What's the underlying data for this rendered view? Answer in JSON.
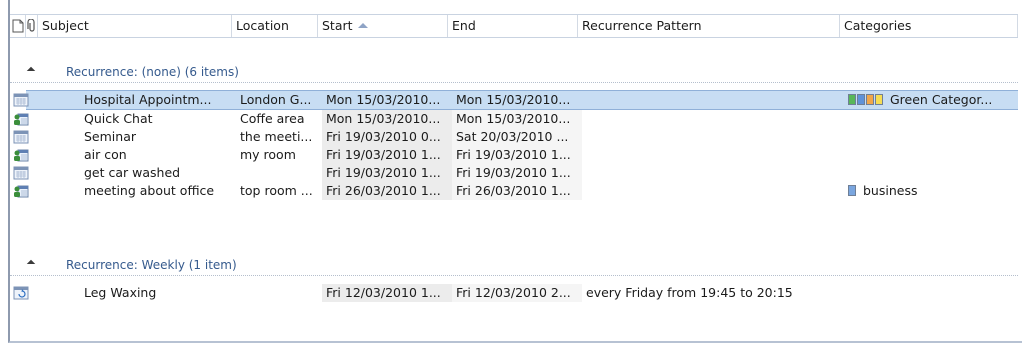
{
  "header": {
    "columns": [
      "Subject",
      "Location",
      "Start",
      "End",
      "Recurrence Pattern",
      "Categories"
    ]
  },
  "groups": [
    {
      "label": "Recurrence: (none) (6 items)",
      "rows": [
        {
          "icon": "appointment-icon",
          "subject": "Hospital Appointm...",
          "location": "London G...",
          "start": "Mon 15/03/2010...",
          "end": "Mon 15/03/2010...",
          "pattern": "",
          "categories": "Green Categor...",
          "swatches": [
            "#58b758",
            "#5f92d8",
            "#f0a64a",
            "#f5dd54"
          ],
          "selected": true
        },
        {
          "icon": "meeting-icon",
          "subject": "Quick Chat",
          "location": "Coffe area",
          "start": "Mon 15/03/2010...",
          "end": "Mon 15/03/2010...",
          "pattern": "",
          "categories": "",
          "swatches": []
        },
        {
          "icon": "appointment-icon",
          "subject": "Seminar",
          "location": "the meeti...",
          "start": "Fri 19/03/2010 0...",
          "end": "Sat 20/03/2010 ...",
          "pattern": "",
          "categories": "",
          "swatches": []
        },
        {
          "icon": "meeting-icon",
          "subject": "air con",
          "location": "my room",
          "start": "Fri 19/03/2010 1...",
          "end": "Fri 19/03/2010 1...",
          "pattern": "",
          "categories": "",
          "swatches": []
        },
        {
          "icon": "appointment-icon",
          "subject": "get car washed",
          "location": "",
          "start": "Fri 19/03/2010 1...",
          "end": "Fri 19/03/2010 1...",
          "pattern": "",
          "categories": "",
          "swatches": []
        },
        {
          "icon": "meeting-icon",
          "subject": "meeting about office",
          "location": "top room ...",
          "start": "Fri 26/03/2010 1...",
          "end": "Fri 26/03/2010 1...",
          "pattern": "",
          "categories": "business",
          "swatches": [
            "#7aa6df"
          ]
        }
      ]
    },
    {
      "label": "Recurrence: Weekly (1 item)",
      "rows": [
        {
          "icon": "recurring-appointment-icon",
          "subject": "Leg Waxing",
          "location": "",
          "start": "Fri 12/03/2010 1...",
          "end": "Fri 12/03/2010 2...",
          "pattern": "every Friday from 19:45 to 20:15",
          "categories": "",
          "swatches": []
        }
      ]
    }
  ]
}
